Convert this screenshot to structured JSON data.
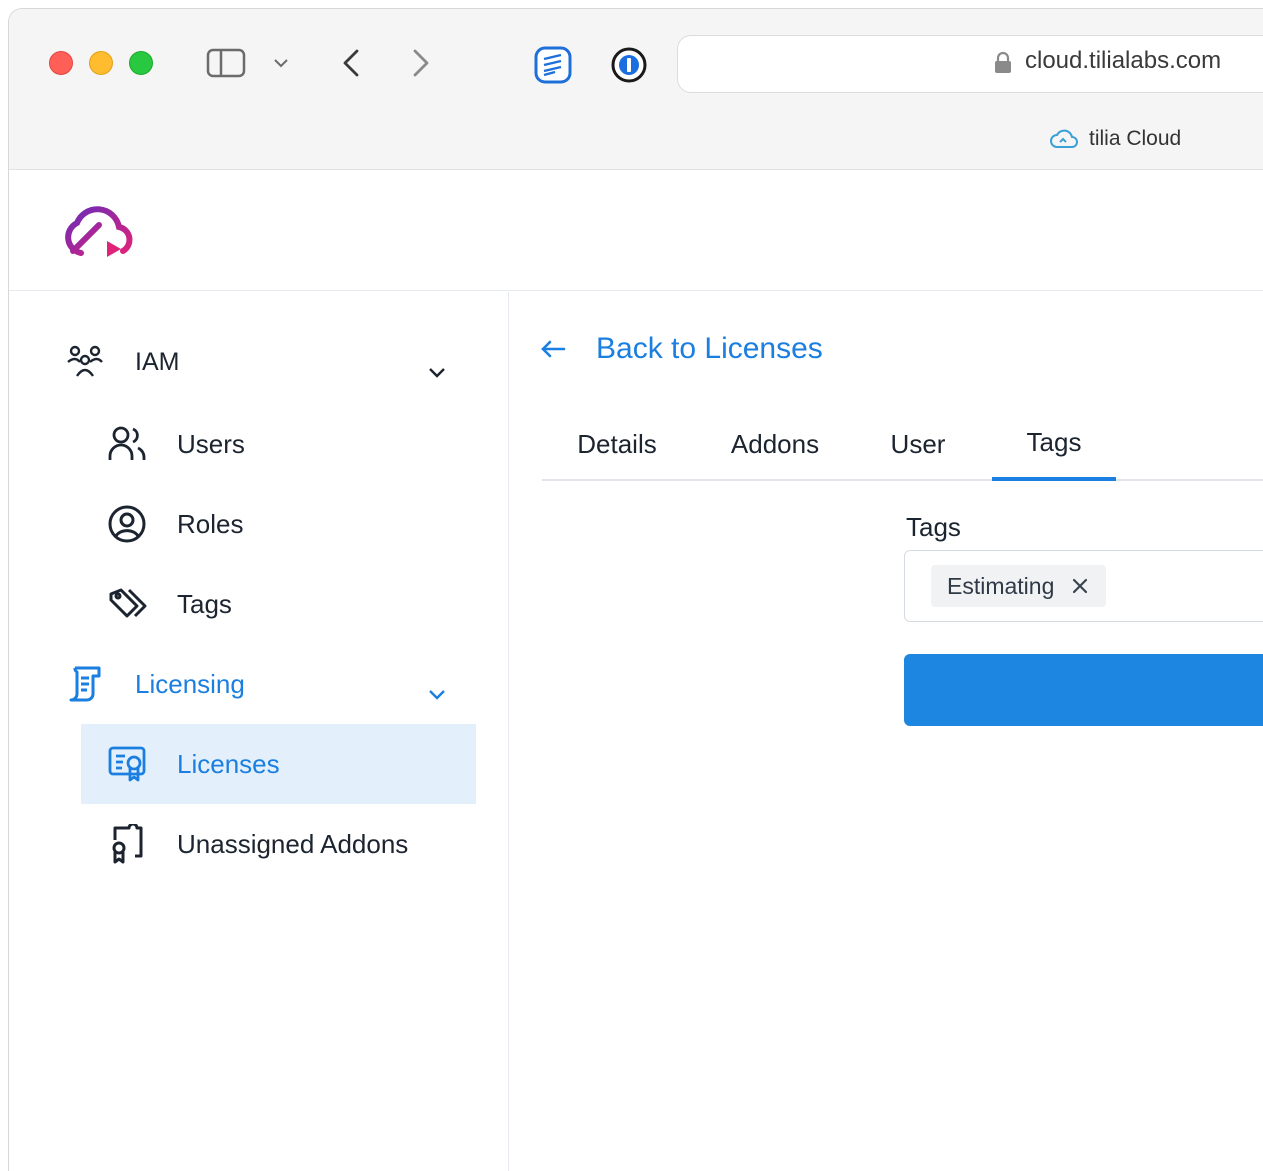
{
  "browser": {
    "url": "cloud.tilialabs.com",
    "tab_title": "tilia Cloud"
  },
  "sidebar": {
    "groups": [
      {
        "label": "IAM",
        "items": [
          {
            "label": "Users",
            "icon": "users-icon"
          },
          {
            "label": "Roles",
            "icon": "roles-icon"
          },
          {
            "label": "Tags",
            "icon": "tag-icon"
          }
        ]
      },
      {
        "label": "Licensing",
        "items": [
          {
            "label": "Licenses",
            "icon": "license-icon",
            "active": true
          },
          {
            "label": "Unassigned Addons",
            "icon": "addon-icon"
          }
        ]
      }
    ]
  },
  "main": {
    "back_label": "Back to Licenses",
    "tabs": [
      {
        "label": "Details"
      },
      {
        "label": "Addons"
      },
      {
        "label": "User"
      },
      {
        "label": "Tags",
        "active": true
      }
    ],
    "tags_field": {
      "label": "Tags",
      "chips": [
        {
          "label": "Estimating"
        }
      ]
    }
  },
  "colors": {
    "accent": "#1a7fe0",
    "active_bg": "#e3f0fb",
    "button": "#1d86e0"
  }
}
